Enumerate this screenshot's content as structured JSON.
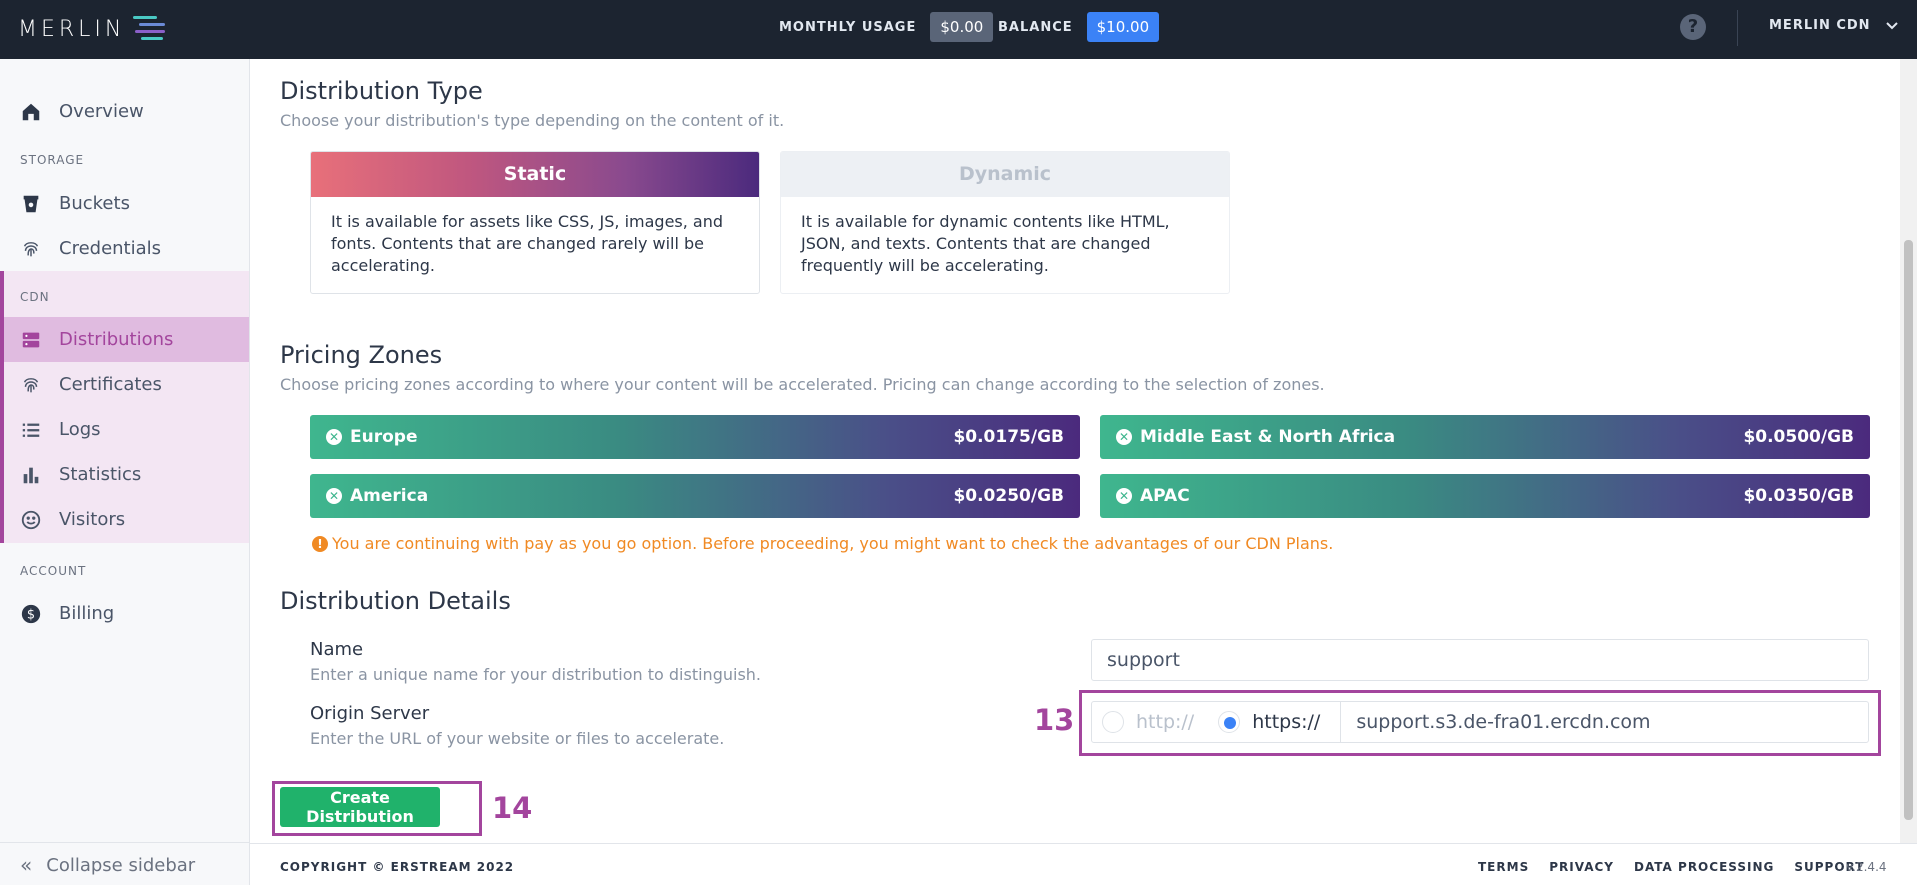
{
  "topbar": {
    "logo": "MERLIN",
    "monthly_usage_label": "MONTHLY USAGE",
    "monthly_usage_value": "$0.00",
    "balance_label": "BALANCE",
    "balance_value": "$10.00",
    "help": "?",
    "account": "MERLIN CDN"
  },
  "sidebar": {
    "overview": "Overview",
    "storage_section": "STORAGE",
    "buckets": "Buckets",
    "credentials": "Credentials",
    "cdn_section": "CDN",
    "distributions": "Distributions",
    "certificates": "Certificates",
    "logs": "Logs",
    "statistics": "Statistics",
    "visitors": "Visitors",
    "account_section": "ACCOUNT",
    "billing": "Billing",
    "collapse": "Collapse sidebar"
  },
  "distribution_type": {
    "title": "Distribution Type",
    "subtitle": "Choose your distribution's type depending on the content of it.",
    "static": {
      "label": "Static",
      "desc": "It is available for assets like CSS, JS, images, and fonts. Contents that are changed rarely will be accelerating."
    },
    "dynamic": {
      "label": "Dynamic",
      "desc": "It is available for dynamic contents like HTML, JSON, and texts. Contents that are changed frequently will be accelerating."
    }
  },
  "pricing": {
    "title": "Pricing Zones",
    "subtitle": "Choose pricing zones according to where your content will be accelerated. Pricing can change according to the selection of zones.",
    "zones": [
      {
        "name": "Europe",
        "price": "$0.0175/GB"
      },
      {
        "name": "Middle East & North Africa",
        "price": "$0.0500/GB"
      },
      {
        "name": "America",
        "price": "$0.0250/GB"
      },
      {
        "name": "APAC",
        "price": "$0.0350/GB"
      }
    ],
    "notice": "You are continuing with pay as you go option. Before proceeding, you might want to check the advantages of our CDN Plans."
  },
  "details": {
    "title": "Distribution Details",
    "name_label": "Name",
    "name_hint": "Enter a unique name for your distribution to distinguish.",
    "name_value": "support",
    "origin_label": "Origin Server",
    "origin_hint": "Enter the URL of your website or files to accelerate.",
    "http": "http://",
    "https": "https://",
    "origin_value": "support.s3.de-fra01.ercdn.com"
  },
  "annotations": {
    "origin": "13",
    "button": "14"
  },
  "create_button": "Create Distribution",
  "footer": {
    "copyright": "COPYRIGHT © ERSTREAM 2022",
    "terms": "TERMS",
    "privacy": "PRIVACY",
    "data_processing": "DATA PROCESSING",
    "support": "SUPPORT",
    "version": "v.2.4.4"
  },
  "colors": {
    "accent": "#a3459d",
    "topbar": "#1c2430",
    "balance": "#3b82f6",
    "button": "#20b26b",
    "warning": "#f08a24"
  }
}
